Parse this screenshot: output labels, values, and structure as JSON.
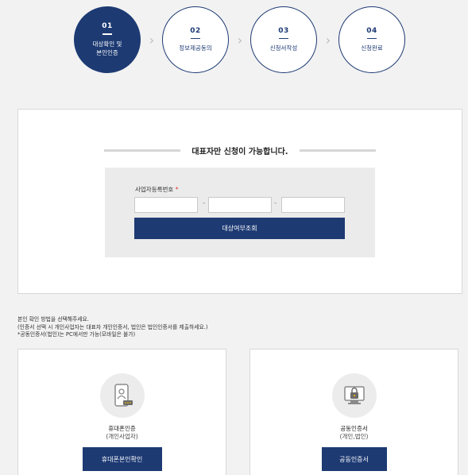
{
  "steps": [
    {
      "num": "01",
      "label": "대상확인 및\n본인인증",
      "active": true
    },
    {
      "num": "02",
      "label": "정보제공동의",
      "active": false
    },
    {
      "num": "03",
      "label": "신청서작성",
      "active": false
    },
    {
      "num": "04",
      "label": "신청완료",
      "active": false
    }
  ],
  "notice": "대표자만 신청이 가능합니다.",
  "form": {
    "label": "사업자등록번호",
    "required_mark": "*",
    "separator": "-",
    "fields": [
      {
        "value": "",
        "placeholder": ""
      },
      {
        "value": "",
        "placeholder": ""
      },
      {
        "value": "",
        "placeholder": ""
      }
    ],
    "check_button": "대상여부조회"
  },
  "guide": [
    "본인 확인 방법을 선택해주세요.",
    "(인증서 선택 시 개인사업자는 대표자 개인인증서, 법인은 법인인증서를 제출하세요.)",
    "*공동인증서(법인)는 PC에서만 가능(모바일은 불가)"
  ],
  "cards": {
    "mobile": {
      "title": "휴대폰인증",
      "subtitle": "(개인사업자)",
      "button": "휴대폰본인확인",
      "icon": "smartphone-id-icon"
    },
    "cert": {
      "title": "공동인증서",
      "subtitle": "(개인,법인)",
      "button": "공동인증서",
      "icon": "lock-certificate-icon"
    }
  },
  "colors": {
    "primary": "#1d3a73",
    "background": "#f2f2f2",
    "panel": "#ebebeb",
    "required": "#d33333"
  }
}
